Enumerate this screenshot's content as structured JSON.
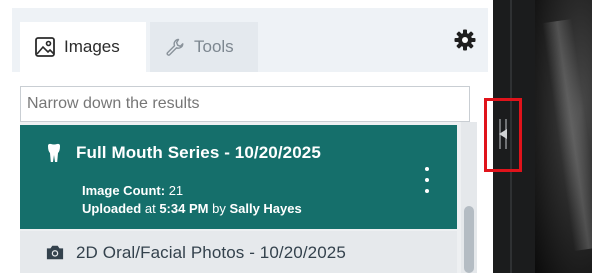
{
  "tabs": [
    {
      "label": "Images",
      "icon": "image-icon",
      "active": true
    },
    {
      "label": "Tools",
      "icon": "wrench-icon",
      "active": false
    }
  ],
  "settings_icon": "gear-icon",
  "search": {
    "placeholder": "Narrow down the results",
    "value": ""
  },
  "list": [
    {
      "title": "Full Mouth Series - 10/20/2025",
      "icon": "tooth-icon",
      "selected": true,
      "count_label": "Image Count:",
      "count": "21",
      "uploaded_label": "Uploaded",
      "uploaded_at": "at",
      "uploaded_time": "5:34 PM",
      "uploaded_by": "by",
      "uploader": "Sally Hayes"
    },
    {
      "title": "2D Oral/Facial Photos - 10/20/2025",
      "icon": "camera-icon",
      "selected": false
    }
  ],
  "colors": {
    "selected_bg": "#156f6b",
    "highlight_border": "#e0131b",
    "divider": "#1b1c1d"
  }
}
